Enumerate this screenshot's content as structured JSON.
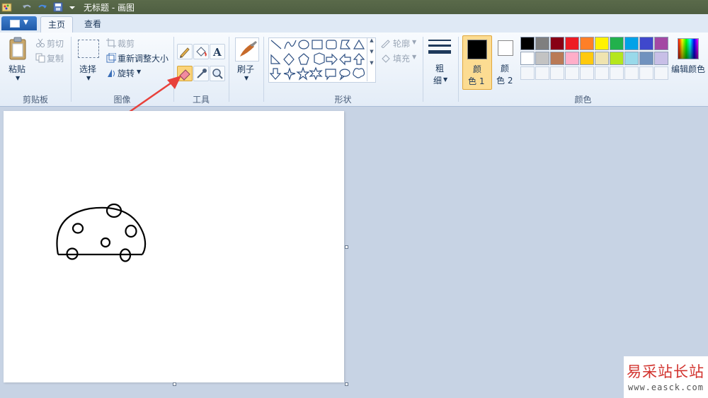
{
  "window": {
    "title": "无标题 - 画图"
  },
  "tabs": [
    {
      "label": "主页"
    },
    {
      "label": "查看"
    }
  ],
  "clipboard": {
    "paste": "粘贴",
    "cut": "剪切",
    "copy": "复制",
    "group": "剪贴板"
  },
  "image": {
    "select": "选择",
    "crop": "裁剪",
    "resize": "重新调整大小",
    "rotate": "旋转",
    "group": "图像"
  },
  "tools": {
    "group": "工具",
    "selected": "eraser-tool"
  },
  "brush": {
    "label": "刷子"
  },
  "shapes": {
    "outline": "轮廓",
    "fill": "填充",
    "group": "形状"
  },
  "size": {
    "label1": "粗",
    "label2": "细"
  },
  "colors": {
    "color1_label1": "颜",
    "color1_label2": "色 1",
    "color2_label1": "颜",
    "color2_label2": "色 2",
    "edit": "编辑颜色",
    "group": "颜色",
    "color1": "#000000",
    "color2": "#ffffff",
    "palette_row1": [
      "#000000",
      "#7f7f7f",
      "#880015",
      "#ed1c24",
      "#ff7f27",
      "#fff200",
      "#22b14c",
      "#00a2e8",
      "#3f48cc",
      "#a349a4"
    ],
    "palette_row2": [
      "#ffffff",
      "#c3c3c3",
      "#b97a57",
      "#ffaec9",
      "#ffc90e",
      "#efe4b0",
      "#b5e61d",
      "#99d9ea",
      "#7092be",
      "#c8bfe7"
    ]
  },
  "watermark": {
    "title": "易采站长站",
    "url": "www.easck.com"
  }
}
